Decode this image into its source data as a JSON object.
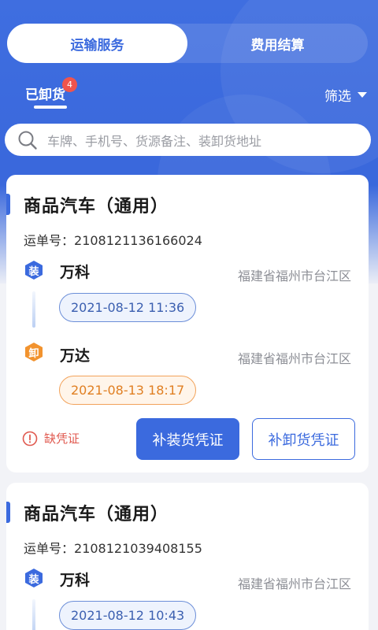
{
  "segmented": {
    "tab_transport": "运输服务",
    "tab_fees": "费用结算"
  },
  "status_tab": {
    "label": "已卸货",
    "badge_count": "4"
  },
  "filter": {
    "label": "筛选"
  },
  "search": {
    "placeholder": "车牌、手机号、货源备注、装卸货地址"
  },
  "orders": [
    {
      "title": "商品汽车（通用）",
      "waybill_label": "运单号：",
      "waybill_no": "2108121136166024",
      "load": {
        "icon_text": "装",
        "name": "万科",
        "address": "福建省福州市台江区",
        "time": "2021-08-12 11:36"
      },
      "unload": {
        "icon_text": "卸",
        "name": "万达",
        "address": "福建省福州市台江区",
        "time": "2021-08-13 18:17"
      },
      "warning": "缺凭证",
      "btn_load_cert": "补装货凭证",
      "btn_unload_cert": "补卸货凭证"
    },
    {
      "title": "商品汽车（通用）",
      "waybill_label": "运单号：",
      "waybill_no": "2108121039408155",
      "load": {
        "icon_text": "装",
        "name": "万科",
        "address": "福建省福州市台江区",
        "time": "2021-08-12 10:43"
      }
    }
  ],
  "colors": {
    "primary": "#3b6ade",
    "load_icon": "#3b6ade",
    "unload_icon": "#f2932e",
    "warning": "#e0594f"
  }
}
